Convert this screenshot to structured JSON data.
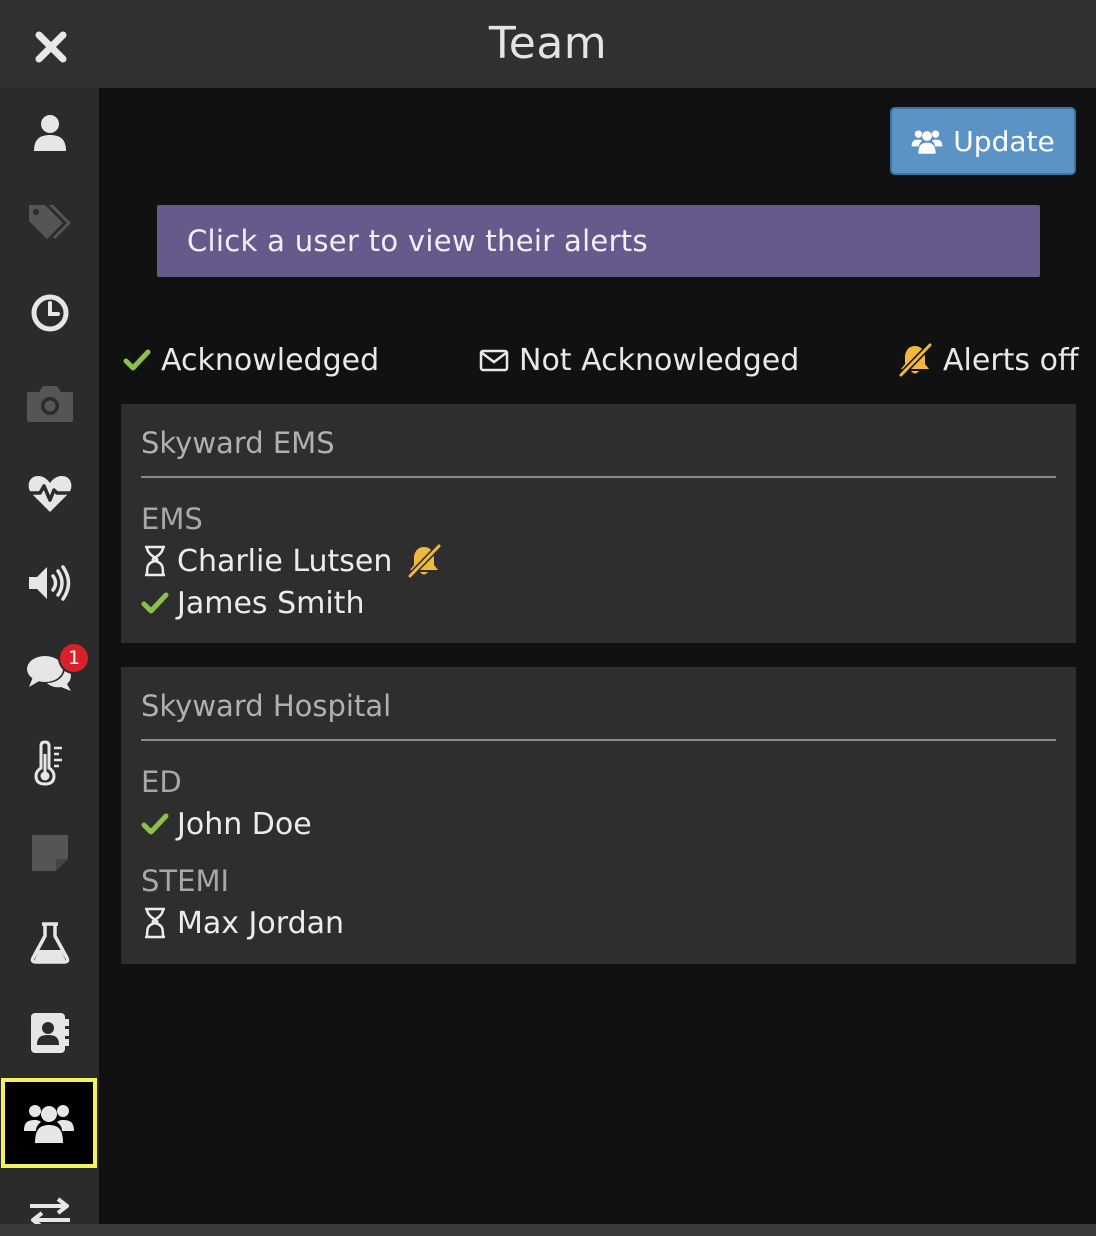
{
  "header": {
    "title": "Team",
    "close_icon": "close-icon"
  },
  "sidebar": {
    "items": [
      {
        "icon": "user-icon",
        "active": false
      },
      {
        "icon": "tags-icon",
        "active": false,
        "disabled": true
      },
      {
        "icon": "clock-icon",
        "active": false
      },
      {
        "icon": "camera-icon",
        "active": false,
        "disabled": true
      },
      {
        "icon": "heartbeat-icon",
        "active": false
      },
      {
        "icon": "volume-icon",
        "active": false
      },
      {
        "icon": "chat-icon",
        "active": false,
        "badge": "1"
      },
      {
        "icon": "thermometer-icon",
        "active": false
      },
      {
        "icon": "note-icon",
        "active": false,
        "disabled": true
      },
      {
        "icon": "flask-icon",
        "active": false
      },
      {
        "icon": "contact-book-icon",
        "active": false
      },
      {
        "icon": "team-icon",
        "active": true
      },
      {
        "icon": "transfer-icon",
        "active": false
      }
    ]
  },
  "toolbar": {
    "update_label": "Update"
  },
  "hint": "Click a user to view their alerts",
  "legend": {
    "acknowledged": "Acknowledged",
    "not_acknowledged": "Not Acknowledged",
    "alerts_off": "Alerts off"
  },
  "teams": [
    {
      "name": "Skyward EMS",
      "groups": [
        {
          "name": "EMS",
          "members": [
            {
              "name": "Charlie Lutsen",
              "status": "pending",
              "alerts_off": true
            },
            {
              "name": "James Smith",
              "status": "acknowledged",
              "alerts_off": false
            }
          ]
        }
      ]
    },
    {
      "name": "Skyward Hospital",
      "groups": [
        {
          "name": "ED",
          "members": [
            {
              "name": "John Doe",
              "status": "acknowledged",
              "alerts_off": false
            }
          ]
        },
        {
          "name": "STEMI",
          "members": [
            {
              "name": "Max Jordan",
              "status": "pending",
              "alerts_off": false
            }
          ]
        }
      ]
    }
  ],
  "colors": {
    "check": "#8dc04b",
    "alerts_off": "#f0b83c",
    "hint_bg": "#665a8d",
    "update_bg": "#5b93c4",
    "active_outline": "#f4f25c",
    "badge": "#d8212a"
  }
}
